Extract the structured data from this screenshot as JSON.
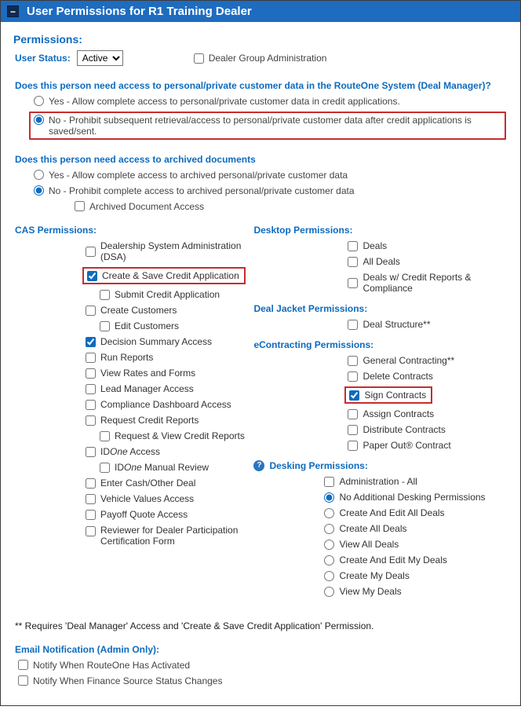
{
  "header": {
    "title": "User Permissions for R1 Training Dealer"
  },
  "permissions_title": "Permissions:",
  "user_status": {
    "label": "User Status:",
    "value": "Active",
    "options": [
      "Active"
    ]
  },
  "dga_label": "Dealer Group Administration",
  "q1": {
    "text": "Does this person need access to personal/private customer data in the RouteOne System (Deal Manager)?",
    "yes": "Yes - Allow complete access to personal/private customer data in credit applications.",
    "no": "No - Prohibit subsequent retrieval/access to personal/private customer data after credit applications is saved/sent."
  },
  "q2": {
    "text": "Does this person need access to archived documents",
    "yes": "Yes - Allow complete access to archived personal/private customer data",
    "no": "No - Prohibit complete access to archived personal/private customer data",
    "archived": "Archived Document Access"
  },
  "cas": {
    "title": "CAS Permissions:",
    "dsa": "Dealership System Administration (DSA)",
    "create_save": "Create & Save Credit Application",
    "submit": "Submit Credit Application",
    "create_cust": "Create Customers",
    "edit_cust": "Edit Customers",
    "decision": "Decision Summary Access",
    "run_reports": "Run Reports",
    "view_rates": "View Rates and Forms",
    "lead_mgr": "Lead Manager Access",
    "compliance": "Compliance Dashboard Access",
    "req_credit": "Request Credit Reports",
    "req_view_credit": "Request & View Credit Reports",
    "idone_access_pre": "ID",
    "idone_access_one": "One",
    "idone_access_post": " Access",
    "idone_manual_pre": "ID",
    "idone_manual_one": "One",
    "idone_manual_post": " Manual Review",
    "enter_cash": "Enter Cash/Other Deal",
    "vehicle_values": "Vehicle Values Access",
    "payoff": "Payoff Quote Access",
    "reviewer": "Reviewer for Dealer Participation Certification Form"
  },
  "desktop": {
    "title": "Desktop Permissions:",
    "deals": "Deals",
    "all_deals": "All Deals",
    "deals_credit": "Deals w/ Credit Reports & Compliance"
  },
  "dealjacket": {
    "title": "Deal Jacket Permissions:",
    "deal_structure": "Deal Structure**"
  },
  "econtract": {
    "title": "eContracting Permissions:",
    "general": "General Contracting**",
    "delete": "Delete Contracts",
    "sign": "Sign Contracts",
    "assign": "Assign Contracts",
    "distribute": "Distribute Contracts",
    "paperout": "Paper Out® Contract"
  },
  "desking": {
    "title": "Desking Permissions:",
    "admin_all": "Administration - All",
    "no_add": "No Additional Desking Permissions",
    "create_edit_all": "Create And Edit All Deals",
    "create_all": "Create All Deals",
    "view_all": "View All Deals",
    "create_edit_my": "Create And Edit My Deals",
    "create_my": "Create My Deals",
    "view_my": "View My Deals"
  },
  "footnote": "** Requires 'Deal Manager' Access and 'Create & Save Credit Application' Permission.",
  "email": {
    "title": "Email Notification (Admin Only):",
    "notify_activated": "Notify When RouteOne Has Activated",
    "notify_fs": "Notify When Finance Source Status Changes"
  }
}
